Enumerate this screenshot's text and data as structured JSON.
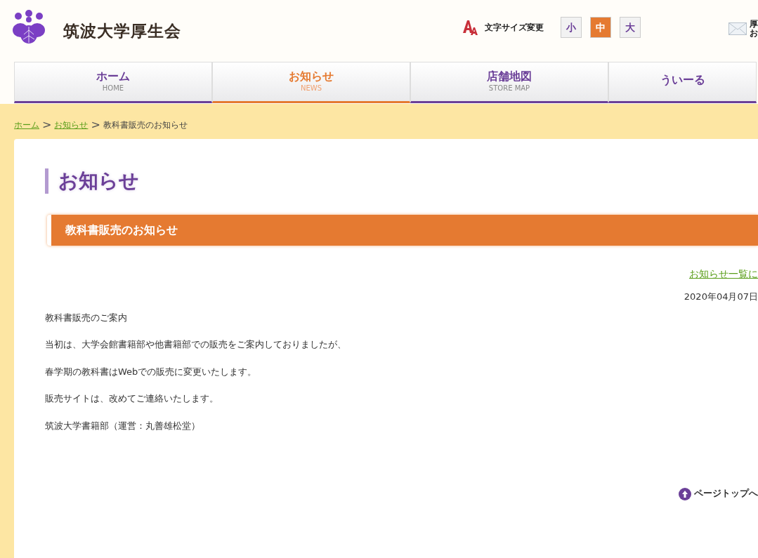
{
  "site_title": "筑波大学厚生会",
  "font_size": {
    "label": "文字サイズ変更",
    "options": [
      {
        "label": "小",
        "selected": false
      },
      {
        "label": "中",
        "selected": true
      },
      {
        "label": "大",
        "selected": false
      }
    ]
  },
  "contact": {
    "lines": [
      "厚",
      "お"
    ]
  },
  "nav": [
    {
      "label": "ホーム",
      "sub": "HOME",
      "selected": false
    },
    {
      "label": "お知らせ",
      "sub": "NEWS",
      "selected": true
    },
    {
      "label": "店舗地図",
      "sub": "STORE MAP",
      "selected": false
    },
    {
      "label": "ういーる",
      "selected": false
    }
  ],
  "breadcrumb": [
    {
      "label": "ホーム",
      "kind": "link"
    },
    {
      "label": ">",
      "kind": "separator"
    },
    {
      "label": "お知らせ",
      "kind": "link"
    },
    {
      "label": ">",
      "kind": "separator"
    },
    {
      "label": "教科書販売のお知らせ",
      "kind": "current"
    }
  ],
  "page_heading": "お知らせ",
  "article_title": "教科書販売のお知らせ",
  "back_link": "お知らせ一覧に",
  "date": "2020年04月07日",
  "paragraphs": [
    "教科書販売のご案内",
    "当初は、大学会館書籍部や他書籍部での販売をご案内しておりましたが、",
    "春学期の教科書はWebでの販売に変更いたします。",
    "販売サイトは、改めてご連絡いたします。",
    "筑波大学書籍部（運営：丸善雄松堂）"
  ],
  "page_top": "ページトップへ"
}
